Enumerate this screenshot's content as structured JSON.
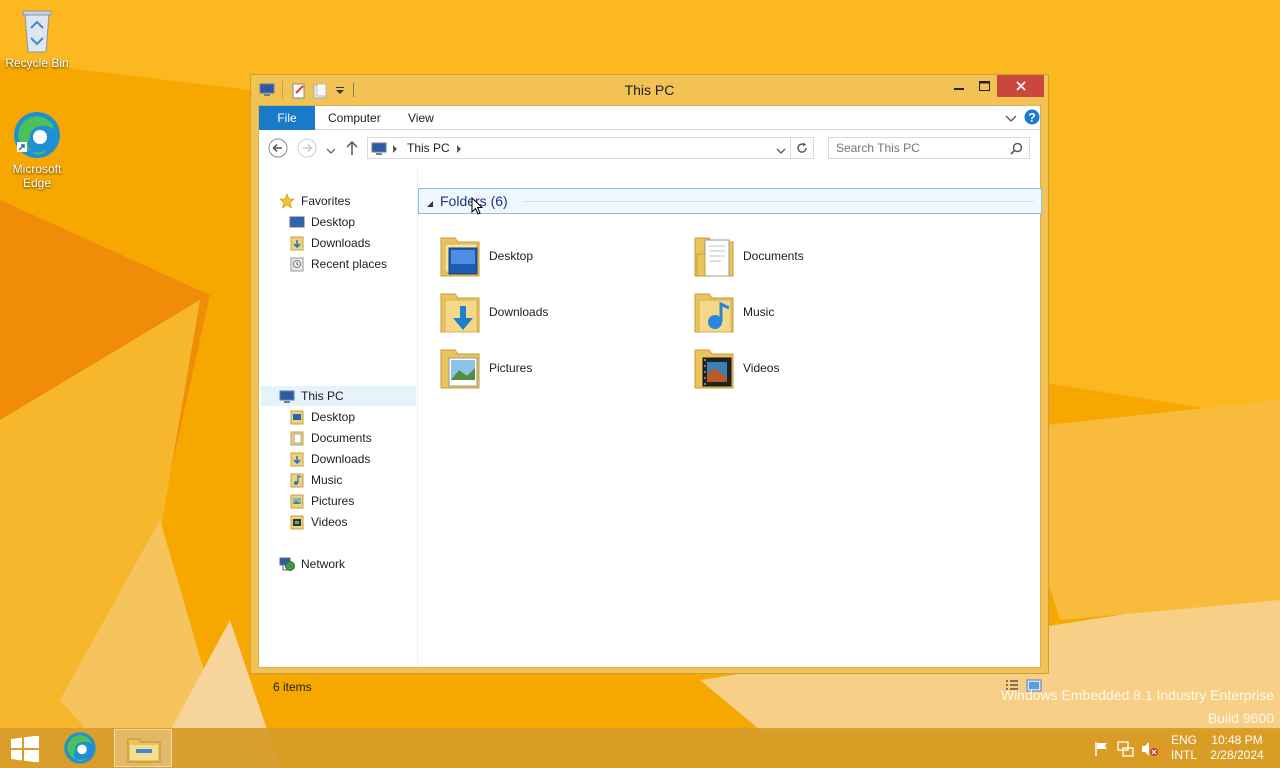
{
  "desktop": {
    "icons": [
      {
        "label": "Recycle Bin",
        "icon": "recycle-bin-icon"
      },
      {
        "label": "Microsoft Edge",
        "icon": "edge-icon"
      }
    ],
    "watermark": {
      "line1": "Windows Embedded 8.1 Industry Enterprise",
      "line2": "Build 9600"
    }
  },
  "window": {
    "title": "This PC",
    "controls": {
      "minimize": "minimize",
      "maximize": "maximize",
      "close": "close"
    },
    "ribbon": {
      "tabs": [
        {
          "label": "File"
        },
        {
          "label": "Computer"
        },
        {
          "label": "View"
        }
      ]
    },
    "address": {
      "crumb": "This PC",
      "search_placeholder": "Search This PC"
    },
    "nav": {
      "favorites": {
        "label": "Favorites",
        "items": [
          {
            "label": "Desktop"
          },
          {
            "label": "Downloads"
          },
          {
            "label": "Recent places"
          }
        ]
      },
      "this_pc": {
        "label": "This PC",
        "items": [
          {
            "label": "Desktop"
          },
          {
            "label": "Documents"
          },
          {
            "label": "Downloads"
          },
          {
            "label": "Music"
          },
          {
            "label": "Pictures"
          },
          {
            "label": "Videos"
          }
        ]
      },
      "network": {
        "label": "Network"
      }
    },
    "content": {
      "group_title": "Folders (6)",
      "folders": [
        {
          "label": "Desktop"
        },
        {
          "label": "Documents"
        },
        {
          "label": "Downloads"
        },
        {
          "label": "Music"
        },
        {
          "label": "Pictures"
        },
        {
          "label": "Videos"
        }
      ]
    },
    "status": {
      "items_count": "6 items"
    }
  },
  "taskbar": {
    "lang_line1": "ENG",
    "lang_line2": "INTL",
    "time": "10:48 PM",
    "date": "2/28/2024"
  },
  "colors": {
    "accent": "#1979ca",
    "wallpaper": "#f5a300",
    "selection": "#e5f3fb"
  }
}
